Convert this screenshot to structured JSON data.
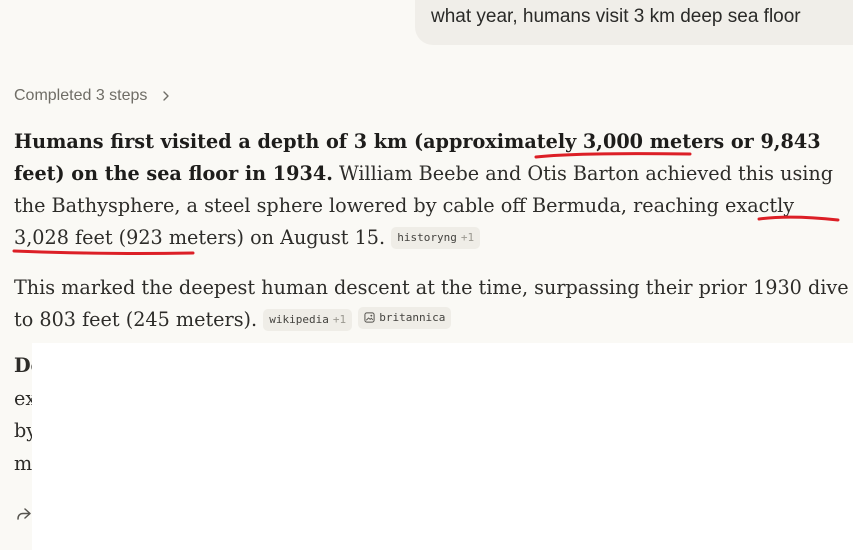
{
  "user_message": "what year, humans visit 3 km deep sea floor",
  "steps_label": "Completed 3 steps",
  "answer": {
    "p1": {
      "bold": "Humans first visited a depth of 3 km (approximately 3,000 meters or 9,843 feet) on the sea floor in 1934.",
      "text": " William Beebe and Otis Barton achieved this using the Bathysphere, a steel sphere lowered by cable off Bermuda, reaching exactly 3,028 feet (923 meters) on August 15. ",
      "sources": [
        {
          "name": "historyng",
          "more": "+1"
        }
      ]
    },
    "p2": {
      "text": "This marked the deepest human descent at the time, surpassing their prior 1930 dive to 803 feet (245 meters). ",
      "sources": [
        {
          "name": "wikipedia",
          "more": "+1"
        },
        {
          "name": "britannica",
          "more": ""
        }
      ]
    },
    "partial_lines": [
      "De",
      "ex",
      "by",
      "m"
    ]
  },
  "icons": {
    "steps_chevron": "chevron-right-icon",
    "share": "share-icon",
    "source_image": "image-icon"
  },
  "colors": {
    "annotation_underline": "#dc1f26",
    "background": "#faf9f5",
    "user_bubble": "#f0eee9",
    "chip": "#efede7"
  }
}
